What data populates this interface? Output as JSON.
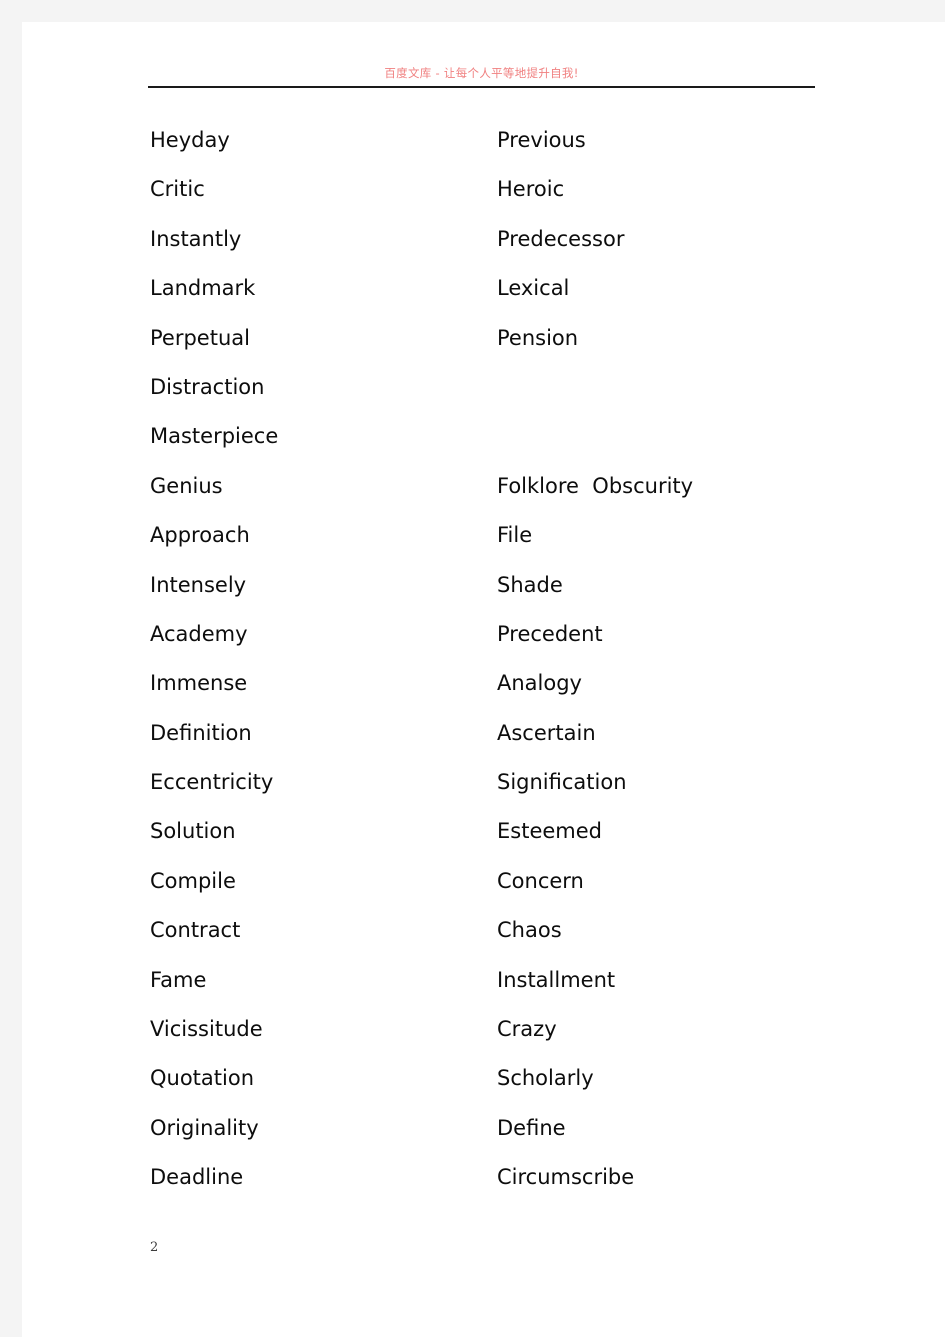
{
  "header": {
    "watermark": "百度文库 - 让每个人平等地提升自我!",
    "watermark_color": "#f08080",
    "rule_color": "#1a1a1a"
  },
  "document": {
    "page_number": "2",
    "background_color": "#ffffff",
    "gutter_color": "#f4f4f4",
    "text_color": "#0d0d0d"
  },
  "word_list": {
    "columns": 2,
    "rows": [
      {
        "left": "Heyday",
        "right": "Previous"
      },
      {
        "left": "Critic",
        "right": "Heroic"
      },
      {
        "left": "Instantly",
        "right": "Predecessor"
      },
      {
        "left": "Landmark",
        "right": "Lexical"
      },
      {
        "left": "Perpetual",
        "right": "Pension"
      },
      {
        "left": "Distraction",
        "right": ""
      },
      {
        "left": "Masterpiece",
        "right": ""
      },
      {
        "left": "Genius",
        "right": "Folklore  Obscurity"
      },
      {
        "left": "Approach",
        "right": "File"
      },
      {
        "left": "Intensely",
        "right": "Shade"
      },
      {
        "left": "Academy",
        "right": "Precedent"
      },
      {
        "left": "Immense",
        "right": "Analogy"
      },
      {
        "left": "Definition",
        "right": "Ascertain"
      },
      {
        "left": "Eccentricity",
        "right": "Signification"
      },
      {
        "left": "Solution",
        "right": "Esteemed"
      },
      {
        "left": "Compile",
        "right": "Concern"
      },
      {
        "left": "Contract",
        "right": "Chaos"
      },
      {
        "left": "Fame",
        "right": "Installment"
      },
      {
        "left": "Vicissitude",
        "right": "Crazy"
      },
      {
        "left": "Quotation",
        "right": "Scholarly"
      },
      {
        "left": "Originality",
        "right": "Define"
      },
      {
        "left": "Deadline",
        "right": "Circumscribe"
      }
    ]
  }
}
